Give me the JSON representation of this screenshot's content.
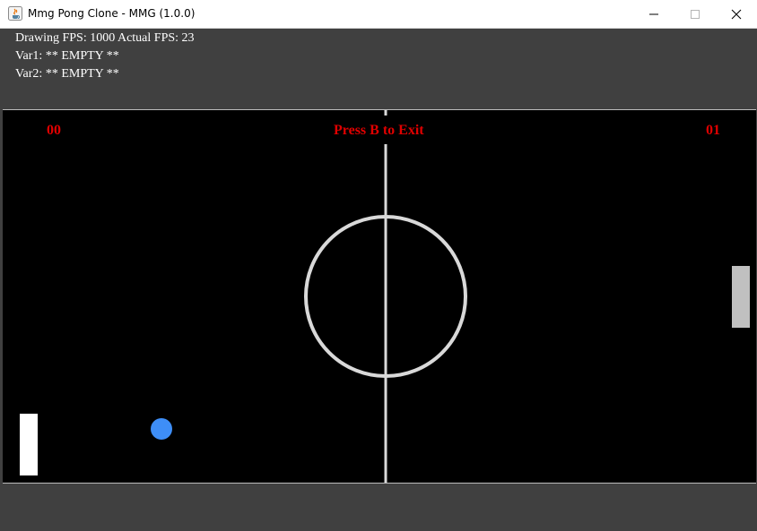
{
  "window": {
    "title": "Mmg Pong Clone - MMG (1.0.0)",
    "icon": "java-cup-icon"
  },
  "debug": {
    "line1": "Drawing FPS: 1000 Actual FPS: 23",
    "line2": "Var1: ** EMPTY **",
    "line3": "Var2: ** EMPTY **"
  },
  "game": {
    "score_left": "00",
    "score_right": "01",
    "message": "Press B to Exit",
    "colors": {
      "text": "#e00000",
      "field": "#000000",
      "lines": "#d9d9d9",
      "ball": "#3e8ef7",
      "left_paddle": "#ffffff",
      "right_paddle": "#c0c0c0"
    }
  }
}
